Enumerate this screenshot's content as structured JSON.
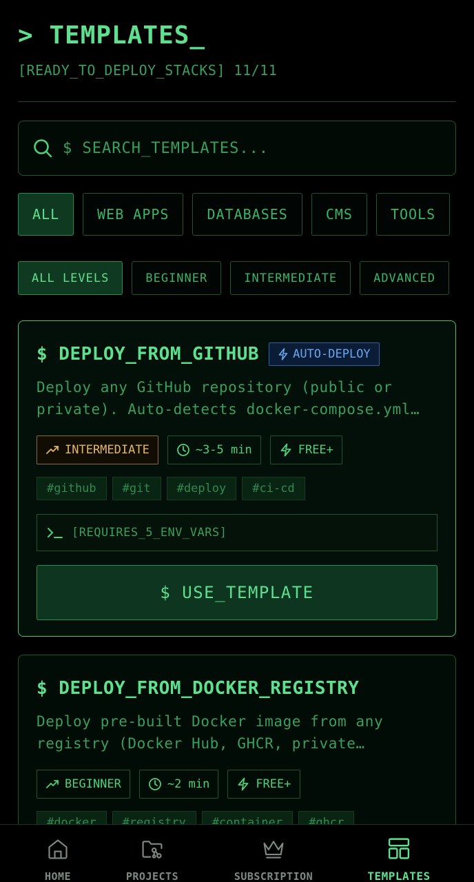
{
  "header": {
    "title": "> TEMPLATES_",
    "subtitle": "[READY_TO_DEPLOY_STACKS] 11/11"
  },
  "search": {
    "placeholder": "$ SEARCH_TEMPLATES...",
    "value": ""
  },
  "categories": [
    {
      "label": "ALL",
      "active": true
    },
    {
      "label": "WEB APPS",
      "active": false
    },
    {
      "label": "DATABASES",
      "active": false
    },
    {
      "label": "CMS",
      "active": false
    },
    {
      "label": "TOOLS",
      "active": false
    }
  ],
  "levels": [
    {
      "label": "ALL LEVELS",
      "active": true
    },
    {
      "label": "BEGINNER",
      "active": false
    },
    {
      "label": "INTERMEDIATE",
      "active": false
    },
    {
      "label": "ADVANCED",
      "active": false
    }
  ],
  "cards": [
    {
      "title": "$ DEPLOY_FROM_GITHUB",
      "badge": "AUTO-DEPLOY",
      "description": "Deploy any GitHub repository (public or private). Auto-detects docker-compose.yml…",
      "level": "INTERMEDIATE",
      "time": "~3-5 min",
      "tier": "FREE+",
      "tags": [
        "#github",
        "#git",
        "#deploy",
        "#ci-cd"
      ],
      "env": "[REQUIRES_5_ENV_VARS]",
      "button": "$ USE_TEMPLATE"
    },
    {
      "title": "$ DEPLOY_FROM_DOCKER_REGISTRY",
      "description": "Deploy pre-built Docker image from any registry (Docker Hub, GHCR, private…",
      "level": "BEGINNER",
      "time": "~2 min",
      "tier": "FREE+",
      "tags": [
        "#docker",
        "#registry",
        "#container",
        "#ghcr"
      ]
    }
  ],
  "nav": [
    {
      "label": "HOME",
      "icon": "home-icon",
      "active": false
    },
    {
      "label": "PROJECTS",
      "icon": "projects-folder-icon",
      "active": false
    },
    {
      "label": "SUBSCRIPTION",
      "icon": "crown-icon",
      "active": false
    },
    {
      "label": "TEMPLATES",
      "icon": "templates-grid-icon",
      "active": true
    }
  ],
  "colors": {
    "accent": "#5fe08e",
    "text_dim": "#3a9e5e",
    "border": "#1d5533",
    "level_intermediate": "#e2b864",
    "badge_blue": "#6aa6f0",
    "nav_inactive": "#7d8a82"
  }
}
